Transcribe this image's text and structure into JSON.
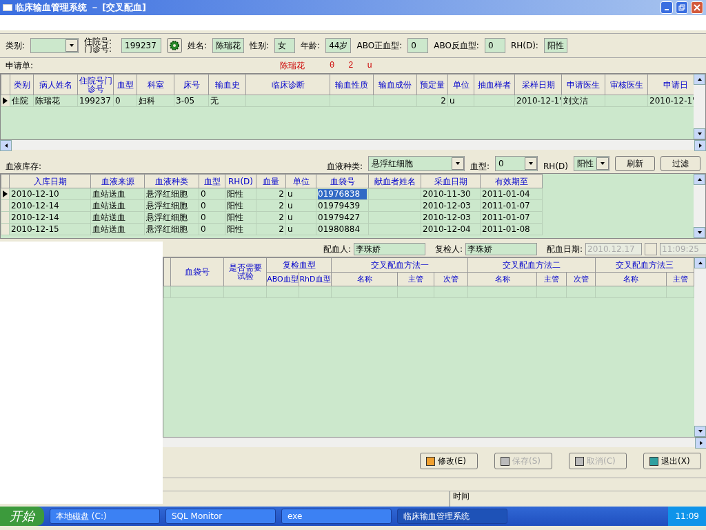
{
  "window": {
    "title": "临床输血管理系统 － [交叉配血]"
  },
  "patient_form": [
    {
      "kind": "select",
      "label": "类别:"
    },
    {
      "kind": "lookup",
      "label": "住院号:门诊号:",
      "value": "199237"
    },
    {
      "kind": "text",
      "label": "姓名:",
      "value": "陈瑞花"
    },
    {
      "kind": "text",
      "label": "性别:",
      "value": "女"
    },
    {
      "kind": "text",
      "label": "年龄:",
      "value": "44岁"
    },
    {
      "kind": "text",
      "label": "ABO正血型:",
      "value": "0"
    },
    {
      "kind": "text",
      "label": "ABO反血型:",
      "value": "0"
    },
    {
      "kind": "text",
      "label": "RH(D):",
      "value": "阳性"
    }
  ],
  "request": {
    "label": "申请单:",
    "summary": [
      "陈瑞花",
      "0",
      "2",
      "u"
    ],
    "columns": [
      "类别",
      "病人姓名",
      "住院号门诊号",
      "血型",
      "科室",
      "床号",
      "输血史",
      "临床诊断",
      "输血性质",
      "输血成份",
      "预定量",
      "单位",
      "抽血样者",
      "采样日期",
      "申请医生",
      "审核医生",
      "申请日"
    ],
    "rows": [
      {
        "selected": true,
        "cells": [
          "住院",
          "陈瑞花",
          "199237",
          "0",
          "妇科",
          "3-05",
          "无",
          "",
          "",
          "",
          "2",
          "u",
          "",
          "2010-12-1'",
          "刘文洁",
          "",
          "2010-12-1'"
        ]
      }
    ]
  },
  "inventory": {
    "label": "血液库存:",
    "filters": [
      {
        "kind": "select",
        "label": "血液种类:",
        "value": "悬浮红细胞"
      },
      {
        "kind": "select",
        "label": "血型:",
        "value": "0"
      },
      {
        "kind": "select",
        "label": "RH(D)",
        "value": "阳性"
      }
    ],
    "buttons": [
      "刷新",
      "过滤"
    ],
    "columns": [
      "入库日期",
      "血液来源",
      "血液种类",
      "血型",
      "RH(D)",
      "血量",
      "单位",
      "血袋号",
      "献血者姓名",
      "采血日期",
      "有效期至"
    ],
    "rows": [
      {
        "selected": true,
        "cells": [
          "2010-12-10",
          "血站送血",
          "悬浮红细胞",
          "0",
          "阳性",
          "2",
          "u",
          "01976838",
          "",
          "2010-11-30",
          "2011-01-04"
        ]
      },
      {
        "selected": false,
        "cells": [
          "2010-12-14",
          "血站送血",
          "悬浮红细胞",
          "0",
          "阳性",
          "2",
          "u",
          "01979439",
          "",
          "2010-12-03",
          "2011-01-07"
        ]
      },
      {
        "selected": false,
        "cells": [
          "2010-12-14",
          "血站送血",
          "悬浮红细胞",
          "0",
          "阳性",
          "2",
          "u",
          "01979427",
          "",
          "2010-12-03",
          "2011-01-07"
        ]
      },
      {
        "selected": false,
        "cells": [
          "2010-12-15",
          "血站送血",
          "悬浮红细胞",
          "0",
          "阳性",
          "2",
          "u",
          "01980884",
          "",
          "2010-12-04",
          "2011-01-08"
        ]
      }
    ]
  },
  "crossmatch": {
    "fields": [
      {
        "label": "配血人:",
        "value": "李珠娇",
        "disabled": false
      },
      {
        "label": "复检人:",
        "value": "李珠娇",
        "disabled": false
      },
      {
        "label": "配血日期:",
        "value": "2010.12.17",
        "disabled": true
      },
      {
        "value": "11:09:25",
        "disabled": true
      }
    ],
    "columns": [
      {
        "label": "血袋号"
      },
      {
        "label": "是否需要试验"
      },
      {
        "label": "复检血型",
        "sub": [
          "ABO血型",
          "RhD血型"
        ]
      },
      {
        "label": "交叉配血方法一",
        "sub": [
          "名称",
          "主管",
          "次管"
        ]
      },
      {
        "label": "交叉配血方法二",
        "sub": [
          "名称",
          "主管",
          "次管"
        ]
      },
      {
        "label": "交叉配血方法三",
        "sub": [
          "名称",
          "主管"
        ]
      }
    ]
  },
  "actions": [
    {
      "label": "修改(E)",
      "disabled": false
    },
    {
      "label": "保存(S)",
      "disabled": true
    },
    {
      "label": "取消(C)",
      "disabled": true
    },
    {
      "label": "退出(X)",
      "disabled": false
    }
  ],
  "status_bar": [
    "时间"
  ],
  "taskbar": {
    "start": "开始",
    "items": [
      {
        "label": "本地磁盘 (C:)",
        "selected": false
      },
      {
        "label": "SQL Monitor",
        "selected": false
      },
      {
        "label": "exe",
        "selected": false
      },
      {
        "label": "临床输血管理系统",
        "selected": true
      }
    ],
    "clock": "11:09"
  }
}
